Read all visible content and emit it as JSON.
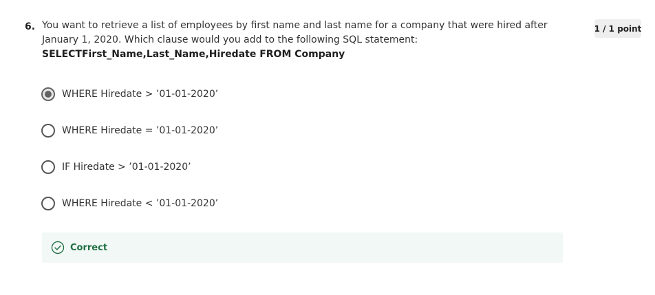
{
  "question": {
    "number": "6.",
    "text": "You want to retrieve a list of employees by first name and last name for a company that were hired after January 1, 2020. Which clause would you add to the following SQL statement: ",
    "sql": "SELECTFirst_Name,Last_Name,Hiredate FROM Company",
    "points": "1 / 1 point"
  },
  "options": [
    {
      "label": "WHERE Hiredate > ’01-01-2020’",
      "selected": true
    },
    {
      "label": "WHERE Hiredate = ’01-01-2020’",
      "selected": false
    },
    {
      "label": "IF Hiredate > ’01-01-2020’",
      "selected": false
    },
    {
      "label": "WHERE Hiredate < ’01-01-2020’",
      "selected": false
    }
  ],
  "feedback": {
    "label": "Correct",
    "icon": "check-circle-icon",
    "color": "#1f6e43"
  }
}
